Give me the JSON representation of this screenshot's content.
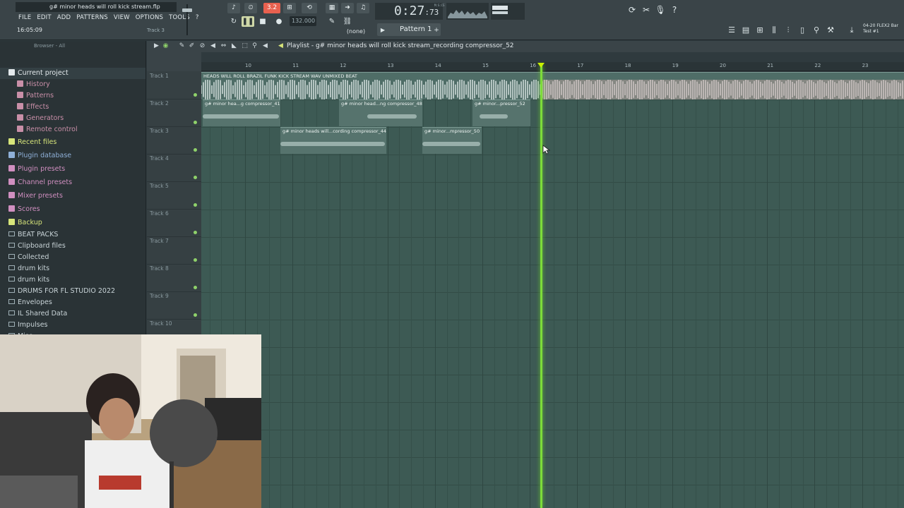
{
  "window": {
    "file_title": "g# minor heads will roll kick stream.flp"
  },
  "menu": [
    "FILE",
    "EDIT",
    "ADD",
    "PATTERNS",
    "VIEW",
    "OPTIONS",
    "TOOLS",
    "?"
  ],
  "hint_bar": {
    "time": "16:05:09",
    "track": "Track 3"
  },
  "transport": {
    "mode_value": "3.2",
    "tempo": "132.000",
    "song_time": "0:27",
    "song_time_frac": ":73",
    "time_unit": "M:S:CS",
    "snap": "(none)",
    "pattern": "Pattern 1"
  },
  "flex": {
    "line1": "04-20  FLEX2 Bar",
    "line2": "Test #1"
  },
  "browser": {
    "header": "Browser - All",
    "items": [
      {
        "label": "Current project",
        "kind": "header",
        "color": "#e3e9ec"
      },
      {
        "label": "History",
        "kind": "sub",
        "color": "#c98fa8"
      },
      {
        "label": "Patterns",
        "kind": "sub",
        "color": "#c98fa8"
      },
      {
        "label": "Effects",
        "kind": "sub",
        "color": "#c98fa8"
      },
      {
        "label": "Generators",
        "kind": "sub",
        "color": "#c98fa8"
      },
      {
        "label": "Remote control",
        "kind": "sub",
        "color": "#c98fa8"
      },
      {
        "label": "Recent files",
        "kind": "top",
        "color": "#d7e57a"
      },
      {
        "label": "Plugin database",
        "kind": "top",
        "color": "#8fb0d8"
      },
      {
        "label": "Plugin presets",
        "kind": "top",
        "color": "#d08fc0"
      },
      {
        "label": "Channel presets",
        "kind": "top",
        "color": "#d08fc0"
      },
      {
        "label": "Mixer presets",
        "kind": "top",
        "color": "#d08fc0"
      },
      {
        "label": "Scores",
        "kind": "top",
        "color": "#d08fc0"
      },
      {
        "label": "Backup",
        "kind": "top",
        "color": "#d7e57a"
      },
      {
        "label": "BEAT PACKS",
        "kind": "folder",
        "color": "#c9d4d8"
      },
      {
        "label": "Clipboard files",
        "kind": "folder",
        "color": "#c9d4d8"
      },
      {
        "label": "Collected",
        "kind": "folder",
        "color": "#c9d4d8"
      },
      {
        "label": "drum kits",
        "kind": "folder",
        "color": "#c9d4d8"
      },
      {
        "label": "drum kits",
        "kind": "folder",
        "color": "#c9d4d8"
      },
      {
        "label": "DRUMS FOR FL STUDIO 2022",
        "kind": "folder",
        "color": "#c9d4d8"
      },
      {
        "label": "Envelopes",
        "kind": "folder",
        "color": "#c9d4d8"
      },
      {
        "label": "IL Shared Data",
        "kind": "folder",
        "color": "#c9d4d8"
      },
      {
        "label": "Impulses",
        "kind": "folder",
        "color": "#c9d4d8"
      },
      {
        "label": "Misc",
        "kind": "folder",
        "color": "#c9d4d8"
      }
    ]
  },
  "playlist": {
    "title": "Playlist - g# minor heads will roll kick stream_recording compressor_52",
    "ruler": [
      "10",
      "11",
      "12",
      "13",
      "14",
      "15",
      "16",
      "17",
      "18",
      "19",
      "20",
      "21",
      "22",
      "23"
    ],
    "tracks": [
      "Track 1",
      "Track 2",
      "Track 3",
      "Track 4",
      "Track 5",
      "Track 6",
      "Track 7",
      "Track 8",
      "Track 9",
      "Track 10"
    ],
    "clips": {
      "track1": "HEADS WILL ROLL BRAZIL FUNK KICK STREAM WAV UNMIXED BEAT",
      "t2a": "g# minor hea...g compressor_41",
      "t2b": "g# minor head...ng compressor_48",
      "t2c": "g# minor...pressor_52",
      "t3a": "g# minor heads will...cording compressor_44",
      "t3b": "g# minor...mpressor_50"
    }
  }
}
